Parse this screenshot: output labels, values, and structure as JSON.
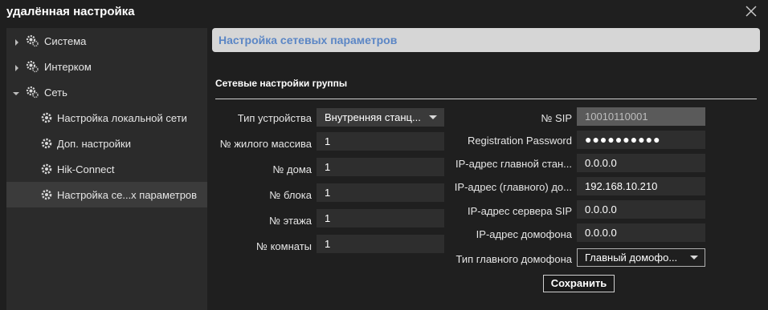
{
  "window": {
    "title": "удалённая настройка"
  },
  "sidebar": {
    "items": [
      {
        "label": "Система"
      },
      {
        "label": "Интерком"
      },
      {
        "label": "Сеть"
      },
      {
        "label": "Настройка локальной сети"
      },
      {
        "label": "Доп. настройки"
      },
      {
        "label": "Hik-Connect"
      },
      {
        "label": "Настройка се...х параметров"
      }
    ]
  },
  "main": {
    "header_title": "Настройка сетевых параметров",
    "section_title": "Сетевые настройки группы",
    "left_fields": [
      {
        "label": "Тип устройства",
        "value": "Внутренняя станц..."
      },
      {
        "label": "№ жилого массива",
        "value": "1"
      },
      {
        "label": "№ дома",
        "value": "1"
      },
      {
        "label": "№ блока",
        "value": "1"
      },
      {
        "label": "№ этажа",
        "value": "1"
      },
      {
        "label": "№ комнаты",
        "value": "1"
      }
    ],
    "right_fields": [
      {
        "label": "№ SIP",
        "value": "10010110001"
      },
      {
        "label": "Registration Password",
        "value": "●●●●●●●●●●"
      },
      {
        "label": "IP-адрес главной стан...",
        "value": "0.0.0.0"
      },
      {
        "label": "IP-адрес (главного) до...",
        "value": "192.168.10.210"
      },
      {
        "label": "IP-адрес сервера SIP",
        "value": "0.0.0.0"
      },
      {
        "label": "IP-адрес домофона",
        "value": "0.0.0.0"
      },
      {
        "label": "Тип главного домофона",
        "value": "Главный домофо..."
      }
    ],
    "save_label": "Сохранить"
  }
}
